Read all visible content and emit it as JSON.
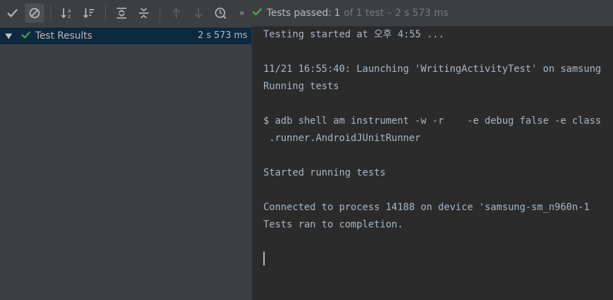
{
  "toolbar": {
    "buttons": [
      {
        "icon": "show-passed-icon",
        "active": false
      },
      {
        "icon": "show-ignored-icon",
        "active": true
      },
      {
        "icon": "sort-alphabetically-icon",
        "active": false
      },
      {
        "icon": "sort-by-duration-icon",
        "active": false
      },
      {
        "icon": "expand-all-icon",
        "active": false
      },
      {
        "icon": "collapse-all-icon",
        "active": false
      },
      {
        "icon": "previous-failed-test-icon",
        "active": false
      },
      {
        "icon": "next-failed-test-icon",
        "active": false
      },
      {
        "icon": "test-history-icon",
        "active": false
      }
    ],
    "chevron": "»",
    "status_label": "Tests passed:",
    "status_count": "1",
    "status_rest": "of 1 test – 2 s 573 ms"
  },
  "tree": {
    "root_label": "Test Results",
    "root_duration": "2 s 573 ms"
  },
  "console": {
    "lines": [
      "Testing started at 오후 4:55 ...",
      "",
      "11/21 16:55:40: Launching 'WritingActivityTest' on samsung",
      "Running tests",
      "",
      "$ adb shell am instrument -w -r    -e debug false -e class",
      " .runner.AndroidJUnitRunner",
      "",
      "Started running tests",
      "",
      "Connected to process 14188 on device 'samsung-sm_n960n-1",
      "Tests ran to completion."
    ]
  },
  "colors": {
    "success": "#499c54",
    "toolbar_bg": "#3c3f41",
    "selection_bg": "#0d293e",
    "console_bg": "#2b2b2b"
  }
}
